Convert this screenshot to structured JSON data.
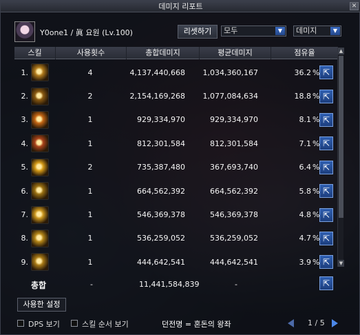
{
  "window": {
    "title": "데미지 리포트",
    "close_label": "✕"
  },
  "user": {
    "name": "Y0one1 / 眞 요원 (Lv.100)"
  },
  "controls": {
    "reset_label": "리셋하기",
    "filter_value": "모두",
    "metric_value": "데미지"
  },
  "columns": [
    "스킬",
    "사용횟수",
    "총합데미지",
    "평균데미지",
    "점유율"
  ],
  "rows": [
    {
      "rank": "1.",
      "count": "4",
      "total": "4,137,440,668",
      "avg": "1,034,360,167",
      "pct": "36.2",
      "icon": "golden-slash-skill-icon",
      "color": "#b07a1c"
    },
    {
      "rank": "2.",
      "count": "2",
      "total": "2,154,169,268",
      "avg": "1,077,084,634",
      "pct": "18.8",
      "icon": "golden-text-skill-icon",
      "color": "#8a5a12"
    },
    {
      "rank": "3.",
      "count": "1",
      "total": "929,334,970",
      "avg": "929,334,970",
      "pct": "8.1",
      "icon": "orange-blade-skill-icon",
      "color": "#c46614"
    },
    {
      "rank": "4.",
      "count": "1",
      "total": "812,301,584",
      "avg": "812,301,584",
      "pct": "7.1",
      "icon": "fire-strike-skill-icon",
      "color": "#a8421a"
    },
    {
      "rank": "5.",
      "count": "2",
      "total": "735,387,480",
      "avg": "367,693,740",
      "pct": "6.4",
      "icon": "sun-burst-skill-icon",
      "color": "#d49a18"
    },
    {
      "rank": "6.",
      "count": "1",
      "total": "664,562,392",
      "avg": "664,562,392",
      "pct": "5.8",
      "icon": "golden-pierce-skill-icon",
      "color": "#9a7012"
    },
    {
      "rank": "7.",
      "count": "1",
      "total": "546,369,378",
      "avg": "546,369,378",
      "pct": "4.8",
      "icon": "light-rush-skill-icon",
      "color": "#c9951e"
    },
    {
      "rank": "8.",
      "count": "1",
      "total": "536,259,052",
      "avg": "536,259,052",
      "pct": "4.7",
      "icon": "crescent-slash-skill-icon",
      "color": "#b48618"
    },
    {
      "rank": "9.",
      "count": "1",
      "total": "444,642,541",
      "avg": "444,642,541",
      "pct": "3.9",
      "icon": "spiral-skill-icon",
      "color": "#a87a16"
    }
  ],
  "pct_sign": "%",
  "share_glyph": "⇱",
  "total": {
    "label": "총합",
    "count": "-",
    "sum": "11,441,584,839",
    "avg": "-"
  },
  "used_settings_label": "사용한 설정",
  "footer": {
    "dps_label": "DPS 보기",
    "order_label": "스킬 순서 보기",
    "dungeon": "던전명 = 혼돈의 왕좌",
    "page": "1 / 5"
  }
}
